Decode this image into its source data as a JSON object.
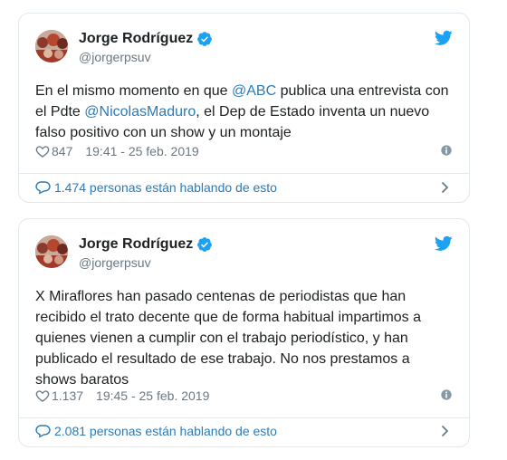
{
  "tweets": [
    {
      "display_name": "Jorge Rodríguez",
      "handle": "@jorgerpsuv",
      "text_parts": {
        "p1": "En el mismo momento en que ",
        "m1": "@ABC",
        "p2": " publica una entrevista con el Pdte ",
        "m2": "@NicolasMaduro",
        "p3": ", el Dep de Estado inventa un nuevo falso positivo con un show y un montaje"
      },
      "likes": "847",
      "timestamp": "19:41 - 25 feb. 2019",
      "talking": "1.474 personas están hablando de esto"
    },
    {
      "display_name": "Jorge Rodríguez",
      "handle": "@jorgerpsuv",
      "text": "X Miraflores han pasado centenas de periodistas que han recibido el trato decente que de forma habitual impartimos a quienes vienen a cumplir con el trabajo periodístico, y han publicado el resultado de ese trabajo. No nos prestamos a shows baratos",
      "likes": "1.137",
      "timestamp": "19:45 - 25 feb. 2019",
      "talking": "2.081 personas están hablando de esto"
    }
  ],
  "icons": {
    "verified": "verified-badge-icon",
    "bird": "twitter-bird-icon",
    "heart": "heart-icon",
    "info": "info-icon",
    "bubble": "speech-bubble-icon",
    "chevron": "chevron-right-icon"
  },
  "colors": {
    "link": "#2b7bb9",
    "twitter_blue": "#1da1f2",
    "text": "#1c2022",
    "muted": "#697882",
    "border": "#e1e8ed"
  }
}
